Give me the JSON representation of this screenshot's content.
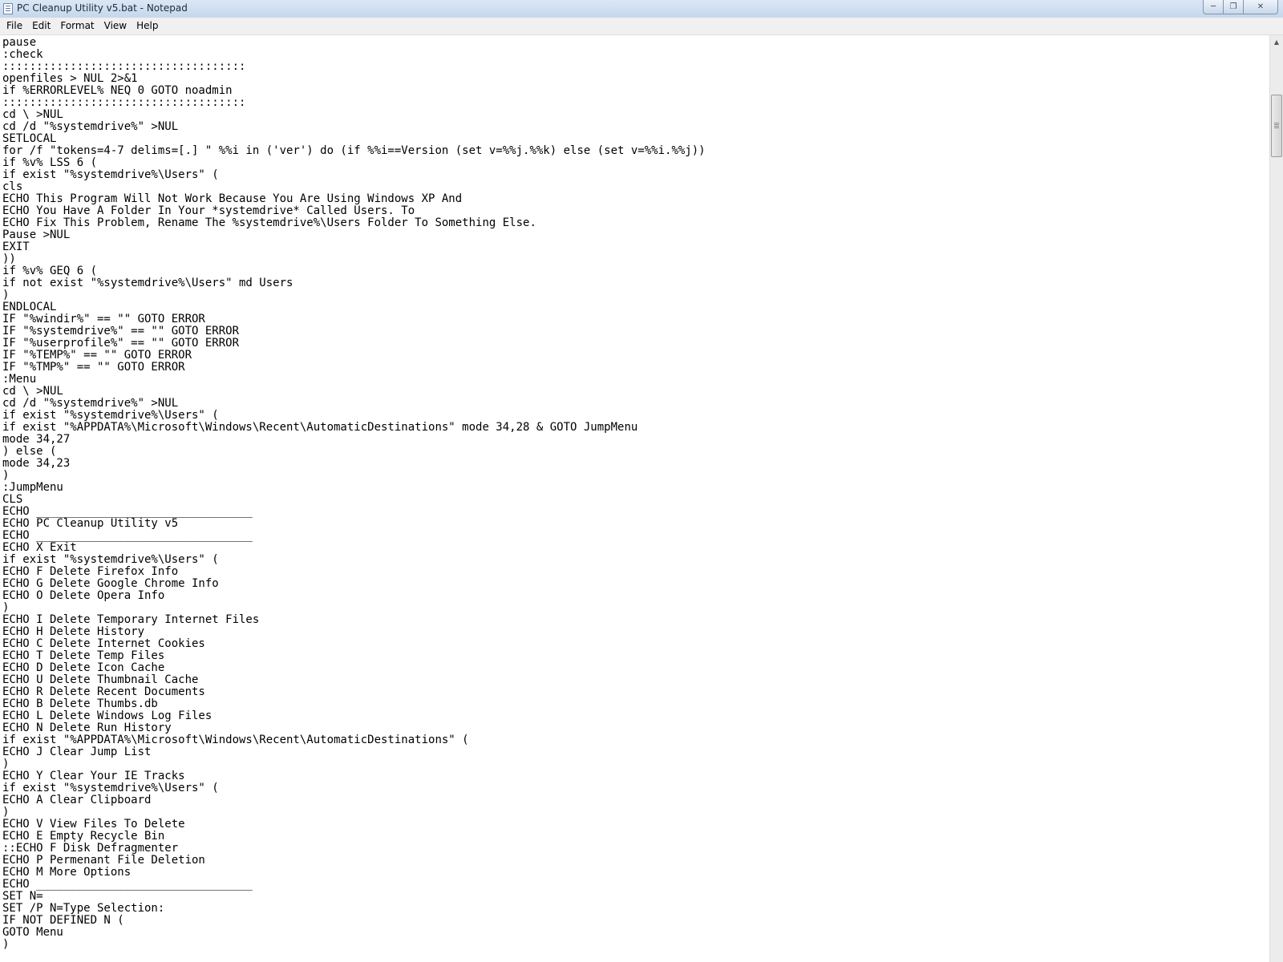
{
  "window": {
    "title": "PC Cleanup Utility v5.bat - Notepad",
    "icon": "notepad-icon",
    "controls": {
      "minimize": "minimize-icon",
      "maximize": "maximize-icon",
      "close": "close-icon"
    }
  },
  "menu": {
    "file": "File",
    "edit": "Edit",
    "format": "Format",
    "view": "View",
    "help": "Help"
  },
  "document": {
    "text": "pause\n:check\n::::::::::::::::::::::::::::::::::::\nopenfiles > NUL 2>&1\nif %ERRORLEVEL% NEQ 0 GOTO noadmin\n::::::::::::::::::::::::::::::::::::\ncd \\ >NUL\ncd /d \"%systemdrive%\" >NUL\nSETLOCAL\nfor /f \"tokens=4-7 delims=[.] \" %%i in ('ver') do (if %%i==Version (set v=%%j.%%k) else (set v=%%i.%%j))\nif %v% LSS 6 (\nif exist \"%systemdrive%\\Users\" (\ncls\nECHO This Program Will Not Work Because You Are Using Windows XP And\nECHO You Have A Folder In Your *systemdrive* Called Users. To\nECHO Fix This Problem, Rename The %systemdrive%\\Users Folder To Something Else.\nPause >NUL\nEXIT\n))\nif %v% GEQ 6 (\nif not exist \"%systemdrive%\\Users\" md Users\n)\nENDLOCAL\nIF \"%windir%\" == \"\" GOTO ERROR\nIF \"%systemdrive%\" == \"\" GOTO ERROR\nIF \"%userprofile%\" == \"\" GOTO ERROR\nIF \"%TEMP%\" == \"\" GOTO ERROR\nIF \"%TMP%\" == \"\" GOTO ERROR\n:Menu\ncd \\ >NUL\ncd /d \"%systemdrive%\" >NUL\nif exist \"%systemdrive%\\Users\" (\nif exist \"%APPDATA%\\Microsoft\\Windows\\Recent\\AutomaticDestinations\" mode 34,28 & GOTO JumpMenu\nmode 34,27\n) else (\nmode 34,23\n)\n:JumpMenu\nCLS\nECHO ________________________________\nECHO PC Cleanup Utility v5\nECHO ________________________________\nECHO X Exit\nif exist \"%systemdrive%\\Users\" (\nECHO F Delete Firefox Info\nECHO G Delete Google Chrome Info\nECHO O Delete Opera Info\n)\nECHO I Delete Temporary Internet Files\nECHO H Delete History\nECHO C Delete Internet Cookies\nECHO T Delete Temp Files\nECHO D Delete Icon Cache\nECHO U Delete Thumbnail Cache\nECHO R Delete Recent Documents\nECHO B Delete Thumbs.db\nECHO L Delete Windows Log Files\nECHO N Delete Run History\nif exist \"%APPDATA%\\Microsoft\\Windows\\Recent\\AutomaticDestinations\" (\nECHO J Clear Jump List\n)\nECHO Y Clear Your IE Tracks\nif exist \"%systemdrive%\\Users\" (\nECHO A Clear Clipboard\n)\nECHO V View Files To Delete\nECHO E Empty Recycle Bin\n::ECHO F Disk Defragmenter\nECHO P Permenant File Deletion\nECHO M More Options\nECHO ________________________________\nSET N=\nSET /P N=Type Selection:\nIF NOT DEFINED N (\nGOTO Menu\n)"
  },
  "scrollbar": {
    "position": 0.06
  }
}
